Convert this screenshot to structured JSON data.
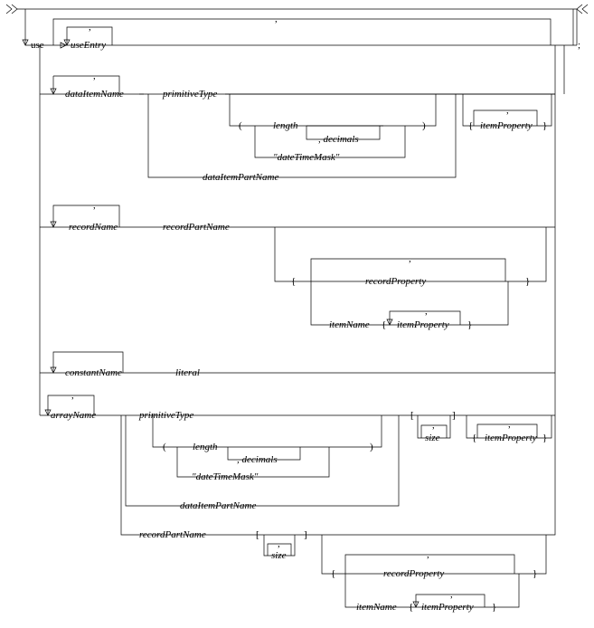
{
  "tokens": {
    "use": "use",
    "useEntry": "useEntry",
    "semicolon": ";",
    "comma_top1": ",",
    "comma_top2": ",",
    "dataItemName": "dataItemName",
    "primitiveType1": "primitiveType",
    "lparen1": "(",
    "length1": "length",
    "commaDecimals1": ", decimals",
    "rparen1": ")",
    "dateTimeMask1": "\"dateTimeMask\"",
    "dataItemPartName1": "dataItemPartName",
    "lbrace_ip1": "{",
    "itemProperty1": "itemProperty",
    "rbrace_ip1": "}",
    "comma_ip1": ",",
    "recordName": "recordName",
    "recordPartName1": "recordPartName",
    "lbrace_rp1": "{",
    "recordProperty1": "recordProperty",
    "rbrace_rp1": "}",
    "comma_rp1": ",",
    "itemName1": "itemName",
    "lbrace_ip2": "{",
    "itemProperty2": "itemProperty",
    "rbrace_ip2": "}",
    "comma_ip2": ",",
    "comma_rn": ",",
    "constantName": "constantName",
    "equals": "=",
    "literal": "literal",
    "comma_cn": ",",
    "arrayName": "arrayName",
    "primitiveType2": "primitiveType",
    "lparen2": "(",
    "length2": "length",
    "commaDecimals2": ", decimals",
    "rparen2": ")",
    "dateTimeMask2": "\"dateTimeMask\"",
    "dataItemPartName2": "dataItemPartName",
    "lbracket1": "[",
    "rbracket1": "]",
    "size1": "size",
    "comma_size1": ",",
    "lbrace_ip3": "{",
    "itemProperty3": "itemProperty",
    "rbrace_ip3": "}",
    "comma_ip3": ",",
    "recordPartName2": "recordPartName",
    "lbracket2": "[",
    "rbracket2": "]",
    "size2": "size",
    "comma_size2": ",",
    "lbrace_rp2": "{",
    "recordProperty2": "recordProperty",
    "rbrace_rp2": "}",
    "comma_rp2": ",",
    "itemName2": "itemName",
    "lbrace_ip4": "{",
    "itemProperty4": "itemProperty",
    "rbrace_ip4": "}",
    "comma_ip4": ",",
    "comma_an": ","
  },
  "chart_data": {
    "type": "railroad-syntax-diagram",
    "root": {
      "seq": [
        {
          "optional": {
            "seq": [
              {
                "terminal": "use"
              },
              {
                "repeat_sep": {
                  "item": {
                    "nonterminal": "useEntry"
                  },
                  "sep": ","
                }
              }
            ]
          }
        },
        {
          "repeat_sep": {
            "sep": ",",
            "item": {
              "choice": [
                {
                  "seq": [
                    {
                      "nonterminal": "dataItemName"
                    },
                    {
                      "choice": [
                        {
                          "seq": [
                            {
                              "nonterminal": "primitiveType"
                            },
                            {
                              "optional": {
                                "seq": [
                                  {
                                    "terminal": "("
                                  },
                                  {
                                    "choice": [
                                      {
                                        "seq": [
                                          {
                                            "nonterminal": "length"
                                          },
                                          {
                                            "optional": {
                                              "seq": [
                                                {
                                                  "terminal": ","
                                                },
                                                {
                                                  "nonterminal": "decimals"
                                                }
                                              ]
                                            }
                                          }
                                        ]
                                      },
                                      {
                                        "terminal": "\"dateTimeMask\""
                                      }
                                    ]
                                  },
                                  {
                                    "terminal": ")"
                                  }
                                ]
                              }
                            }
                          ]
                        },
                        {
                          "nonterminal": "dataItemPartName"
                        }
                      ]
                    },
                    {
                      "optional": {
                        "seq": [
                          {
                            "terminal": "{"
                          },
                          {
                            "repeat_sep": {
                              "item": {
                                "nonterminal": "itemProperty"
                              },
                              "sep": ","
                            }
                          },
                          {
                            "terminal": "}"
                          }
                        ]
                      }
                    }
                  ]
                },
                {
                  "seq": [
                    {
                      "nonterminal": "recordName"
                    },
                    {
                      "nonterminal": "recordPartName"
                    },
                    {
                      "optional": {
                        "seq": [
                          {
                            "terminal": "{"
                          },
                          {
                            "repeat_sep": {
                              "sep": ",",
                              "item": {
                                "choice": [
                                  {
                                    "nonterminal": "recordProperty"
                                  },
                                  {
                                    "seq": [
                                      {
                                        "nonterminal": "itemName"
                                      },
                                      {
                                        "terminal": "{"
                                      },
                                      {
                                        "repeat_sep": {
                                          "item": {
                                            "nonterminal": "itemProperty"
                                          },
                                          "sep": ","
                                        }
                                      },
                                      {
                                        "terminal": "}"
                                      }
                                    ]
                                  }
                                ]
                              }
                            }
                          },
                          {
                            "terminal": "}"
                          }
                        ]
                      }
                    }
                  ]
                },
                {
                  "seq": [
                    {
                      "nonterminal": "constantName"
                    },
                    {
                      "terminal": "="
                    },
                    {
                      "nonterminal": "literal"
                    }
                  ]
                },
                {
                  "seq": [
                    {
                      "nonterminal": "arrayName"
                    },
                    {
                      "choice": [
                        {
                          "seq": [
                            {
                              "choice": [
                                {
                                  "seq": [
                                    {
                                      "nonterminal": "primitiveType"
                                    },
                                    {
                                      "optional": {
                                        "seq": [
                                          {
                                            "terminal": "("
                                          },
                                          {
                                            "choice": [
                                              {
                                                "seq": [
                                                  {
                                                    "nonterminal": "length"
                                                  },
                                                  {
                                                    "optional": {
                                                      "seq": [
                                                        {
                                                          "terminal": ","
                                                        },
                                                        {
                                                          "nonterminal": "decimals"
                                                        }
                                                      ]
                                                    }
                                                  }
                                                ]
                                              },
                                              {
                                                "terminal": "\"dateTimeMask\""
                                              }
                                            ]
                                          },
                                          {
                                            "terminal": ")"
                                          }
                                        ]
                                      }
                                    }
                                  ]
                                },
                                {
                                  "nonterminal": "dataItemPartName"
                                }
                              ]
                            },
                            {
                              "terminal": "["
                            },
                            {
                              "repeat_sep": {
                                "item": {
                                  "nonterminal": "size"
                                },
                                "sep": ","
                              }
                            },
                            {
                              "terminal": "]"
                            },
                            {
                              "optional": {
                                "seq": [
                                  {
                                    "terminal": "{"
                                  },
                                  {
                                    "repeat_sep": {
                                      "item": {
                                        "nonterminal": "itemProperty"
                                      },
                                      "sep": ","
                                    }
                                  },
                                  {
                                    "terminal": "}"
                                  }
                                ]
                              }
                            }
                          ]
                        },
                        {
                          "seq": [
                            {
                              "nonterminal": "recordPartName"
                            },
                            {
                              "terminal": "["
                            },
                            {
                              "repeat_sep": {
                                "item": {
                                  "nonterminal": "size"
                                },
                                "sep": ","
                              }
                            },
                            {
                              "terminal": "]"
                            },
                            {
                              "optional": {
                                "seq": [
                                  {
                                    "terminal": "{"
                                  },
                                  {
                                    "repeat_sep": {
                                      "sep": ",",
                                      "item": {
                                        "choice": [
                                          {
                                            "nonterminal": "recordProperty"
                                          },
                                          {
                                            "seq": [
                                              {
                                                "nonterminal": "itemName"
                                              },
                                              {
                                                "terminal": "{"
                                              },
                                              {
                                                "repeat_sep": {
                                                  "item": {
                                                    "nonterminal": "itemProperty"
                                                  },
                                                  "sep": ","
                                                }
                                              },
                                              {
                                                "terminal": "}"
                                              }
                                            ]
                                          }
                                        ]
                                      }
                                    }
                                  },
                                  {
                                    "terminal": "}"
                                  }
                                ]
                              }
                            }
                          ]
                        }
                      ]
                    }
                  ]
                }
              ]
            }
          }
        },
        {
          "terminal": ";"
        }
      ]
    }
  }
}
